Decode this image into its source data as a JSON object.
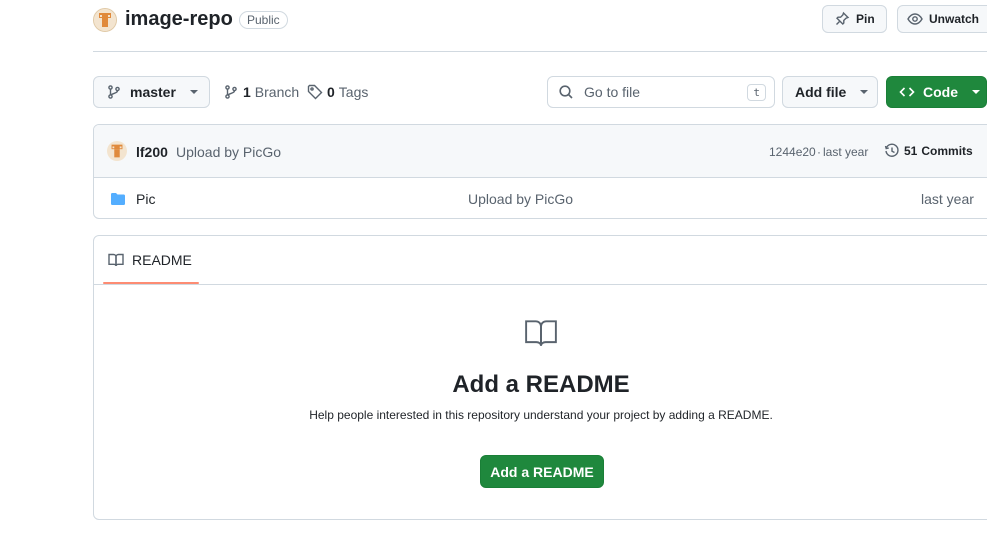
{
  "header": {
    "repo_name": "image-repo",
    "visibility": "Public",
    "pin_label": "Pin",
    "unwatch_label": "Unwatch"
  },
  "toolbar": {
    "branch_name": "master",
    "branch_count": "1",
    "branch_label": "Branch",
    "tag_count": "0",
    "tag_label": "Tags",
    "goto_placeholder": "Go to file",
    "goto_shortcut": "t",
    "add_file_label": "Add file",
    "code_label": "Code"
  },
  "commit": {
    "author": "lf200",
    "message": "Upload by PicGo",
    "sha": "1244e20",
    "separator": "·",
    "time": "last year",
    "commits_count": "51",
    "commits_label": "Commits"
  },
  "files": [
    {
      "name": "Pic",
      "message": "Upload by PicGo",
      "time": "last year",
      "icon": "folder-icon"
    }
  ],
  "readme": {
    "tab_label": "README",
    "title": "Add a README",
    "description": "Help people interested in this repository understand your project by adding a README.",
    "button_label": "Add a README"
  },
  "colors": {
    "accent_green": "#1f883d",
    "folder_blue": "#54aeff",
    "tab_underline": "#fd8c73"
  }
}
